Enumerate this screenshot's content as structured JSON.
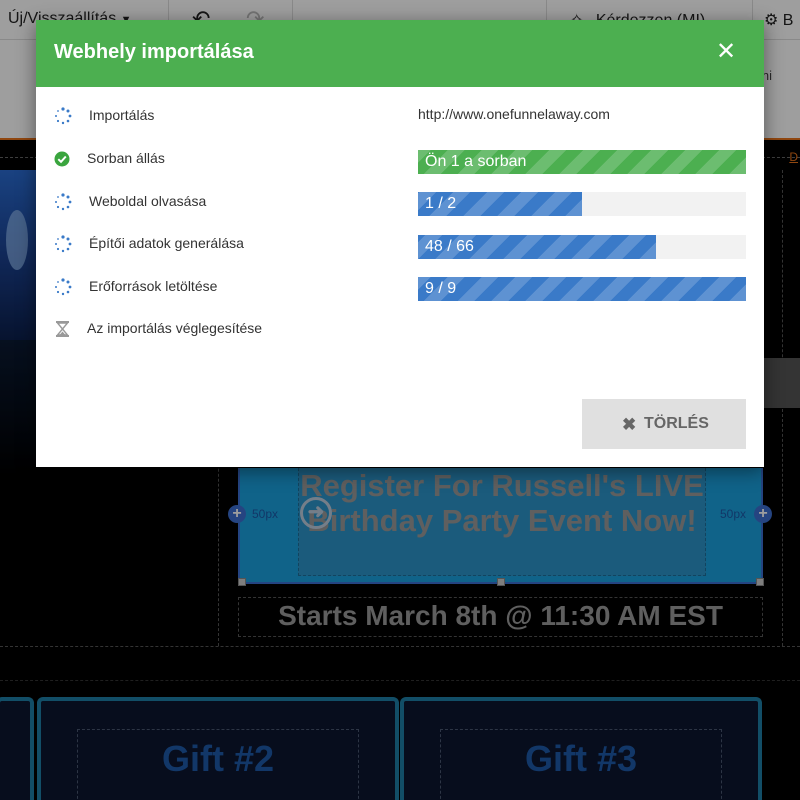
{
  "toolbar": {
    "undo_menu_label": "Új/Visszaállítás",
    "ask_ai_label": "Kérdezzen (MI)",
    "settings_label": "B"
  },
  "subbar": {
    "right_text": "ni",
    "right_link": "D"
  },
  "background": {
    "cta_text": "Register For Russell's LIVE Birthday Party Event Now!",
    "padding_left_label": "50px",
    "padding_right_label": "50px",
    "starts_text": "Starts March 8th @ 11:30 AM EST",
    "gift2_title": "Gift #2",
    "gift3_title": "Gift #3"
  },
  "modal": {
    "title": "Webhely importálása",
    "url": "http://www.onefunnelaway.com",
    "steps": [
      {
        "label": "Importálás",
        "icon": "spinner-icon"
      },
      {
        "label": "Sorban állás",
        "icon": "check-circle-icon"
      },
      {
        "label": "Weboldal olvasása",
        "icon": "spinner-icon"
      },
      {
        "label": "Építői adatok generálása",
        "icon": "spinner-icon"
      },
      {
        "label": "Erőforrások letöltése",
        "icon": "spinner-icon"
      },
      {
        "label": "Az importálás véglegesítése",
        "icon": "hourglass-icon"
      }
    ],
    "progress": [
      {
        "text": "Ön 1 a sorban",
        "fraction": 1.0,
        "color": "#4caf50"
      },
      {
        "text": "1 / 2",
        "fraction": 0.5,
        "color": "#3a7ac8"
      },
      {
        "text": "48 / 66",
        "fraction": 0.727,
        "color": "#3a7ac8"
      },
      {
        "text": "9 / 9",
        "fraction": 1.0,
        "color": "#3a7ac8"
      }
    ],
    "cancel_label": "TÖRLÉS",
    "header_color": "#4caf50"
  }
}
